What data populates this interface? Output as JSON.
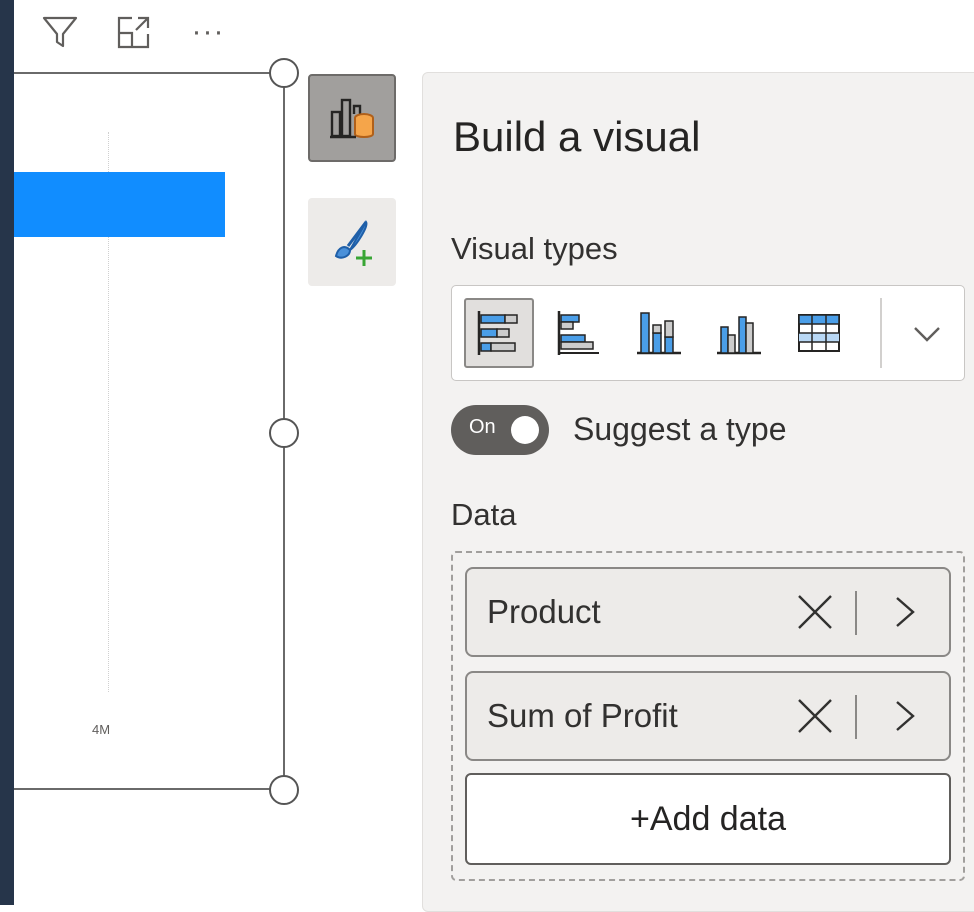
{
  "toolbar": {
    "icons": [
      "filter-icon",
      "focus-mode-icon",
      "more-options-icon"
    ],
    "more_glyph": "···"
  },
  "visual": {
    "bar_color": "#118dff",
    "axis_tick_label": "4M"
  },
  "side_buttons": [
    {
      "icon": "build-visual-icon",
      "active": true
    },
    {
      "icon": "format-visual-icon",
      "active": false
    }
  ],
  "pane": {
    "title": "Build a visual",
    "visual_types_label": "Visual types",
    "visual_types": [
      {
        "icon": "stacked-bar-chart-icon",
        "selected": true
      },
      {
        "icon": "clustered-bar-chart-icon",
        "selected": false
      },
      {
        "icon": "stacked-column-chart-icon",
        "selected": false
      },
      {
        "icon": "clustered-column-chart-icon",
        "selected": false
      },
      {
        "icon": "table-icon",
        "selected": false
      }
    ],
    "suggest_toggle": {
      "state_text": "On",
      "label": "Suggest a type",
      "on": true
    },
    "data_label": "Data",
    "fields": [
      {
        "name": "Product"
      },
      {
        "name": "Sum of Profit"
      }
    ],
    "add_data_label": "+Add data"
  },
  "colors": {
    "accent": "#118dff",
    "pane_bg": "#f3f2f1",
    "dark_edge": "#26354a",
    "plus_green": "#38a534"
  }
}
